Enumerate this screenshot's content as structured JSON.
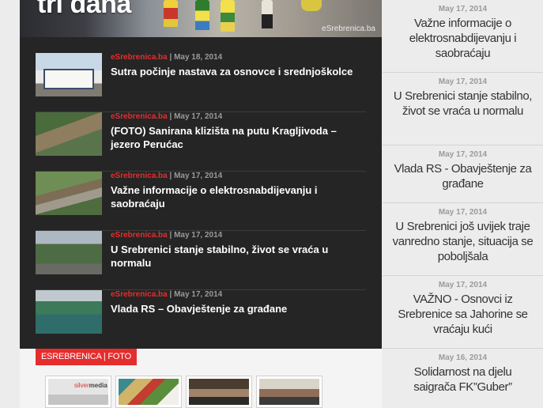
{
  "hero": {
    "title": "tri dana",
    "watermark": "eSrebrenica.ba"
  },
  "news": [
    {
      "source": "eSrebrenica.ba",
      "date": "May 18, 2014",
      "title": "Sutra počinje nastava za osnovce i srednjoškolce"
    },
    {
      "source": "eSrebrenica.ba",
      "date": "May 17, 2014",
      "title": "(FOTO) Sanirana klizišta na putu Kragljivoda – jezero Perućac"
    },
    {
      "source": "eSrebrenica.ba",
      "date": "May 17, 2014",
      "title": "Važne informacije o elektrosnabdijevanju i saobraćaju"
    },
    {
      "source": "eSrebrenica.ba",
      "date": "May 17, 2014",
      "title": "U Srebrenici stanje stabilno, život se vraća u normalu"
    },
    {
      "source": "eSrebrenica.ba",
      "date": "May 17, 2014",
      "title": "Vlada RS – Obavještenje za građane"
    }
  ],
  "meta_separator": " | ",
  "foto": {
    "label": "ESREBRENICA | FOTO",
    "thumb1_logo_a": "silver",
    "thumb1_logo_b": "media"
  },
  "sidebar": [
    {
      "date": "May 17, 2014",
      "title": "Važne informacije o elektrosnabdijevanju i saobraćaju"
    },
    {
      "date": "May 17, 2014",
      "title": "U Srebrenici stanje stabilno, život se vraća u normalu"
    },
    {
      "date": "May 17, 2014",
      "title": "Vlada RS - Obavještenje za građane"
    },
    {
      "date": "May 17, 2014",
      "title": "U Srebrenici još uvijek traje vanredno stanje, situacija se poboljšala"
    },
    {
      "date": "May 17, 2014",
      "title": "VAŽNO - Osnovci iz Srebrenice sa Jahorine se vraćaju kući"
    },
    {
      "date": "May 16, 2014",
      "title": "Solidarnost na djelu saigrača FK”Guber”"
    }
  ],
  "colors": {
    "accent": "#e52d2d",
    "dark_panel": "#252525",
    "sidebar_bg": "#ececec"
  }
}
